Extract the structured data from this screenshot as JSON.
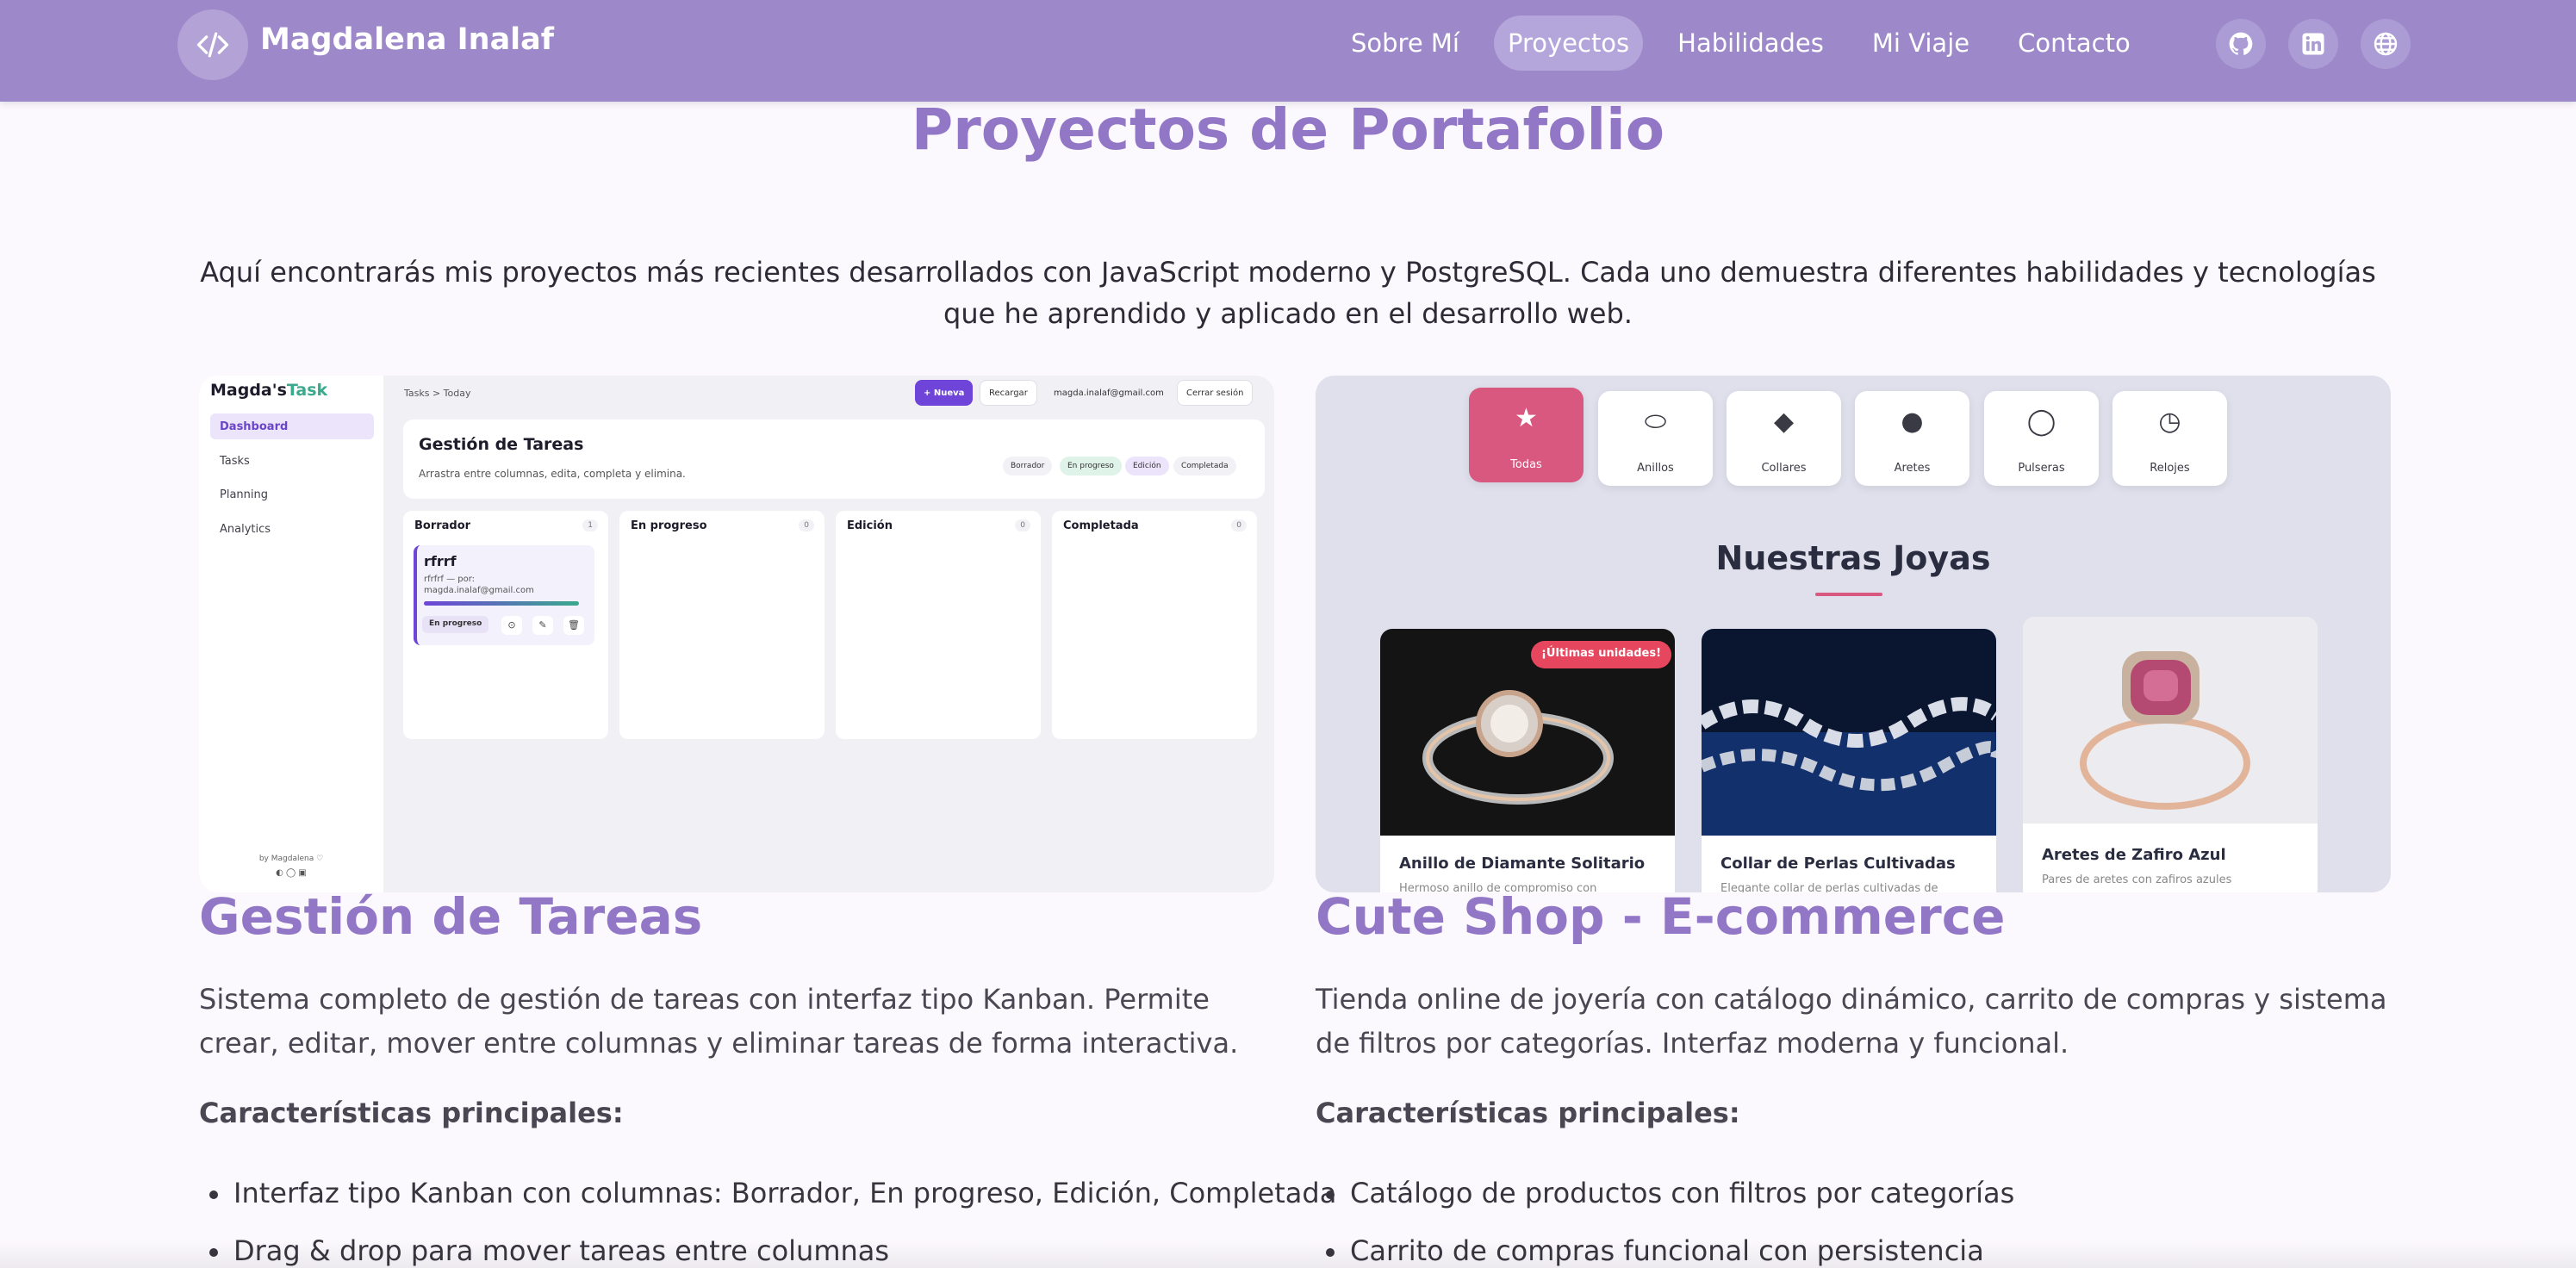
{
  "nav": {
    "brand": "Magdalena Inalaf",
    "links": [
      "Sobre Mí",
      "Proyectos",
      "Habilidades",
      "Mi Viaje",
      "Contacto"
    ],
    "active_link": "Proyectos",
    "social_icons": [
      "github-icon",
      "linkedin-icon",
      "globe-icon"
    ]
  },
  "section": {
    "title": "Proyectos de Portafolio",
    "intro": "Aquí encontrarás mis proyectos más recientes desarrollados con JavaScript moderno y PostgreSQL. Cada uno demuestra diferentes habilidades y tecnologías que he aprendido y aplicado en el desarrollo web."
  },
  "projects": [
    {
      "title": "Gestión de Tareas",
      "description": "Sistema completo de gestión de tareas con interfaz tipo Kanban. Permite crear, editar, mover entre columnas y eliminar tareas de forma interactiva.",
      "features_heading": "Características principales:",
      "features": [
        "Interfaz tipo Kanban con columnas: Borrador, En progreso, Edición, Completada",
        "Drag & drop para mover tareas entre columnas"
      ]
    },
    {
      "title": "Cute Shop - E-commerce",
      "description": "Tienda online de joyería con catálogo dinámico, carrito de compras y sistema de filtros por categorías. Interfaz moderna y funcional.",
      "features_heading": "Características principales:",
      "features": [
        "Catálogo de productos con filtros por categorías",
        "Carrito de compras funcional con persistencia"
      ]
    }
  ],
  "task_app": {
    "logo_a": "Magda's",
    "logo_b": "Task",
    "sidebar": [
      "Dashboard",
      "Tasks",
      "Planning",
      "Analytics"
    ],
    "footer": "by Magdalena ♡",
    "footer_icons": "◐ ◯ ▣",
    "breadcrumb": "Tasks > Today",
    "btn_new": "+ Nueva",
    "btn_reload": "Recargar",
    "user_email": "magda.inalaf@gmail.com",
    "btn_logout": "Cerrar sesión",
    "card_title": "Gestión de Tareas",
    "card_sub": "Arrastra entre columnas, edita, completa y elimina.",
    "badges": [
      "Borrador",
      "En progreso",
      "Edición",
      "Completada"
    ],
    "columns": [
      {
        "title": "Borrador",
        "count": "1"
      },
      {
        "title": "En progreso",
        "count": "0"
      },
      {
        "title": "Edición",
        "count": "0"
      },
      {
        "title": "Completada",
        "count": "0"
      }
    ],
    "task": {
      "title": "rfrrf",
      "sub": "rfrfrf — por: magda.inalaf@gmail.com",
      "state": "En progreso"
    }
  },
  "shop": {
    "categories": [
      "Todas",
      "Anillos",
      "Collares",
      "Aretes",
      "Pulseras",
      "Relojes"
    ],
    "active_category": "Todas",
    "heading": "Nuestras Joyas",
    "products": [
      {
        "name": "Anillo de Diamante Solitario",
        "desc": "Hermoso anillo de compromiso con",
        "tag": "¡Últimas unidades!"
      },
      {
        "name": "Collar de Perlas Cultivadas",
        "desc": "Elegante collar de perlas cultivadas de",
        "tag": ""
      },
      {
        "name": "Aretes de Zafiro Azul",
        "desc": "Pares de aretes con zafiros azules",
        "tag": ""
      }
    ]
  }
}
